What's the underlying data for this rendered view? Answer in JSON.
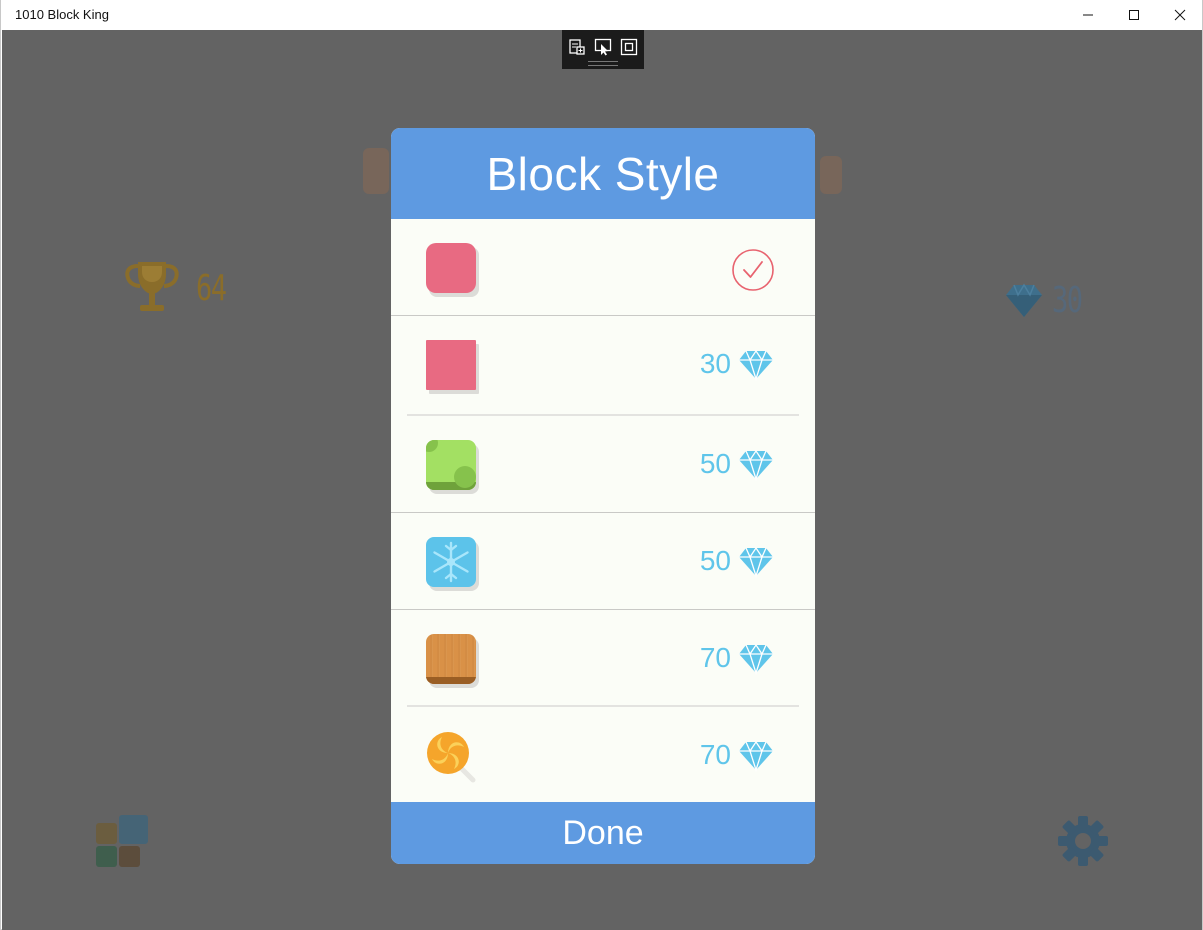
{
  "window": {
    "title": "1010 Block King",
    "minimize_icon": "minimize-icon",
    "maximize_icon": "maximize-icon",
    "close_icon": "close-icon"
  },
  "debug_toolbar": {
    "icons": [
      "live-visual-tree-icon",
      "select-element-icon",
      "display-layout-adorners-icon"
    ]
  },
  "game": {
    "best_score": "64",
    "gems": "30",
    "best_score_icon": "trophy-icon",
    "gems_icon": "diamond-icon",
    "block_style_menu_icon": "block-grid-icon",
    "settings_icon": "gear-icon"
  },
  "dialog": {
    "title": "Block Style",
    "done_label": "Done",
    "accent_color": "#5e9ae1",
    "price_color": "#5fc5ea",
    "styles": [
      {
        "name": "pink-rounded",
        "selected": true,
        "price": ""
      },
      {
        "name": "pink-square",
        "selected": false,
        "price": "30"
      },
      {
        "name": "green-spots",
        "selected": false,
        "price": "50"
      },
      {
        "name": "snowflake",
        "selected": false,
        "price": "50"
      },
      {
        "name": "wood",
        "selected": false,
        "price": "70"
      },
      {
        "name": "candy",
        "selected": false,
        "price": "70"
      }
    ]
  }
}
